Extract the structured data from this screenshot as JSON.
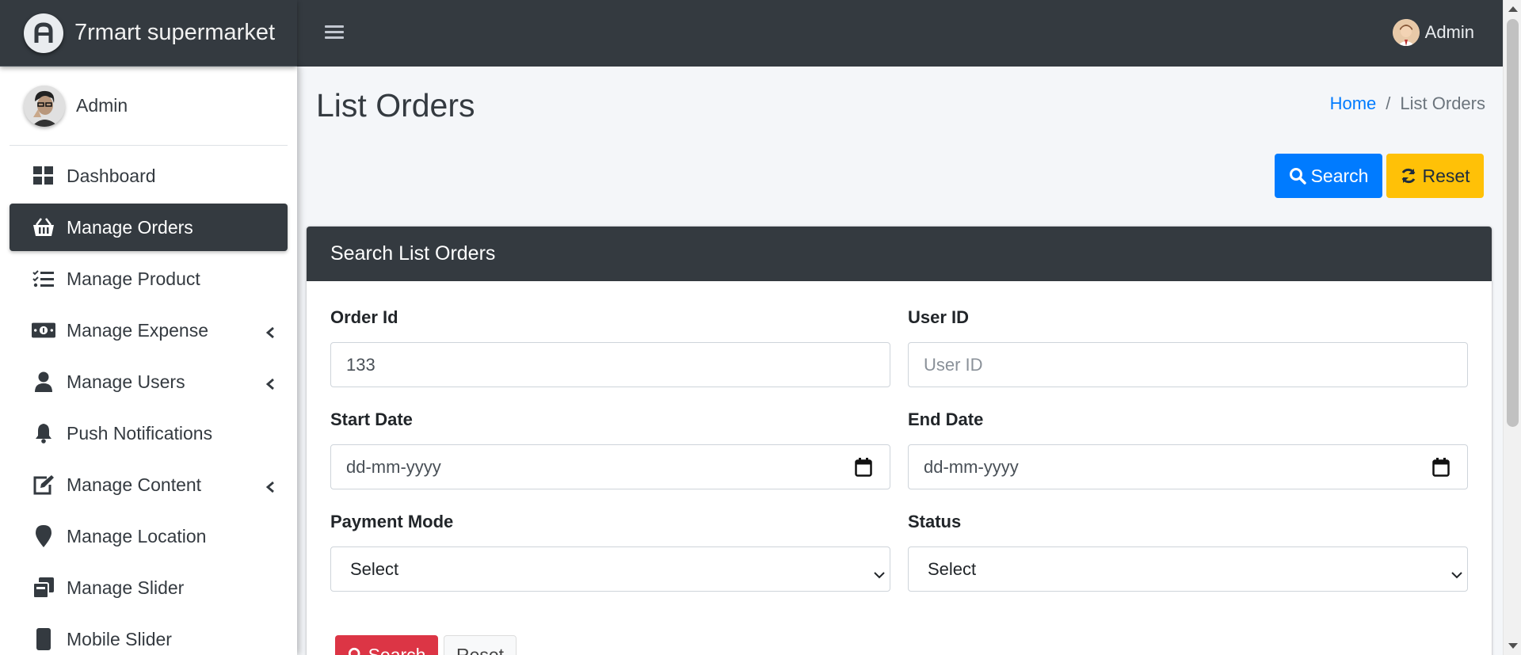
{
  "brand": {
    "name": "7rmart supermarket"
  },
  "topbar": {
    "user_name": "Admin"
  },
  "sidebar": {
    "user_name": "Admin",
    "items": [
      {
        "label": "Dashboard",
        "icon": "dashboard-icon"
      },
      {
        "label": "Manage Orders",
        "icon": "basket-icon",
        "active": true
      },
      {
        "label": "Manage Product",
        "icon": "tasks-icon"
      },
      {
        "label": "Manage Expense",
        "icon": "money-icon",
        "has_submenu": true
      },
      {
        "label": "Manage Users",
        "icon": "user-icon",
        "has_submenu": true
      },
      {
        "label": "Push Notifications",
        "icon": "bell-icon"
      },
      {
        "label": "Manage Content",
        "icon": "edit-icon",
        "has_submenu": true
      },
      {
        "label": "Manage Location",
        "icon": "map-marker-icon"
      },
      {
        "label": "Manage Slider",
        "icon": "images-icon"
      },
      {
        "label": "Mobile Slider",
        "icon": "mobile-icon"
      }
    ]
  },
  "page": {
    "title": "List Orders",
    "breadcrumb": {
      "home": "Home",
      "current": "List Orders"
    },
    "search_label": "Search",
    "reset_label": "Reset"
  },
  "card": {
    "title": "Search List Orders",
    "fields": {
      "order_id": {
        "label": "Order Id",
        "value": "133"
      },
      "user_id": {
        "label": "User ID",
        "placeholder": "User ID"
      },
      "start_date": {
        "label": "Start Date",
        "placeholder": "dd-mm-yyyy"
      },
      "end_date": {
        "label": "End Date",
        "placeholder": "dd-mm-yyyy"
      },
      "payment_mode": {
        "label": "Payment Mode",
        "selected": "Select"
      },
      "status": {
        "label": "Status",
        "selected": "Select"
      }
    },
    "search_label": "Search",
    "reset_label": "Reset"
  },
  "colors": {
    "navbar": "#343a40",
    "primary": "#007bff",
    "warning": "#ffc107",
    "danger": "#dc3545",
    "link": "#007bff"
  }
}
